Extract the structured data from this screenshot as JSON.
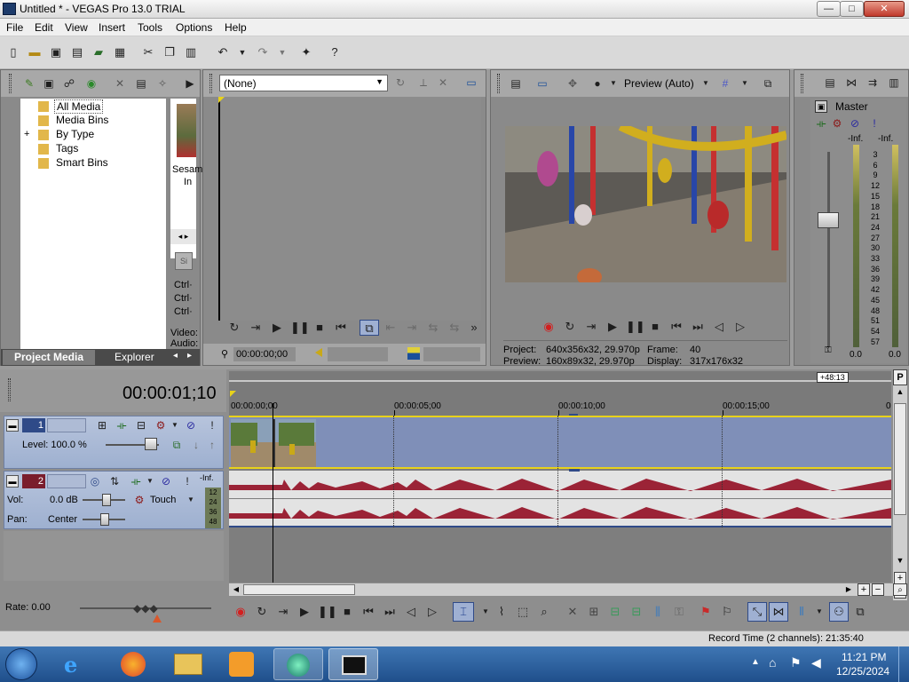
{
  "window": {
    "title": "Untitled * - VEGAS Pro 13.0 TRIAL",
    "min": "—",
    "max": "□",
    "close": "✕"
  },
  "menu": [
    "File",
    "Edit",
    "View",
    "Insert",
    "Tools",
    "Options",
    "Help"
  ],
  "project_media": {
    "tree": [
      "All Media",
      "Media Bins",
      "By Type",
      "Tags",
      "Smart Bins"
    ],
    "expander": "+",
    "thumb_label1": "Sesam",
    "thumb_label2": "In",
    "ctrl_rows": [
      "Ctrl·",
      "Ctrl·",
      "Ctrl·"
    ],
    "video_label": "Video:",
    "audio_label": "Audio:",
    "tabs": [
      "Project Media",
      "Explorer"
    ]
  },
  "trimmer": {
    "dropdown": "(None)",
    "timecode": "00:00:00;00"
  },
  "preview": {
    "mode": "Preview (Auto)",
    "project_label": "Project:",
    "project_value": "640x356x32, 29.970p",
    "frame_label": "Frame:",
    "frame_value": "40",
    "preview_label": "Preview:",
    "preview_value": "160x89x32, 29.970p",
    "display_label": "Display:",
    "display_value": "317x176x32"
  },
  "master": {
    "label": "Master",
    "inf_left": "-Inf.",
    "inf_right": "-Inf.",
    "scale": [
      "3",
      "6",
      "9",
      "12",
      "15",
      "18",
      "21",
      "24",
      "27",
      "30",
      "33",
      "36",
      "39",
      "42",
      "45",
      "48",
      "51",
      "54",
      "57"
    ],
    "value_left": "0.0",
    "value_right": "0.0"
  },
  "timeline": {
    "timecode": "00:00:01;10",
    "ruler_top": "+48:13",
    "ruler_marks": [
      "00:00:00;00",
      "00:00:05;00",
      "00:00:10;00",
      "00:00:15;00",
      "0"
    ],
    "video_track": {
      "number": "1",
      "level": "Level: 100.0 %"
    },
    "audio_track": {
      "number": "2",
      "vol_label": "Vol:",
      "vol_value": "0.0 dB",
      "pan_label": "Pan:",
      "pan_value": "Center",
      "mode": "Touch",
      "inf": "-Inf.",
      "meter": [
        "12",
        "24",
        "36",
        "48"
      ]
    },
    "rate": "Rate: 0.00"
  },
  "status": {
    "record_time": "Record Time (2 channels): 21:35:40"
  },
  "taskbar": {
    "time": "11:21 PM",
    "date": "12/25/2024"
  },
  "colors": {
    "accent": "#2f4a88",
    "track": "#9eb0d0",
    "video_region": "#7f8fb8",
    "waveform": "#9b2336",
    "record": "#d21f1f"
  }
}
